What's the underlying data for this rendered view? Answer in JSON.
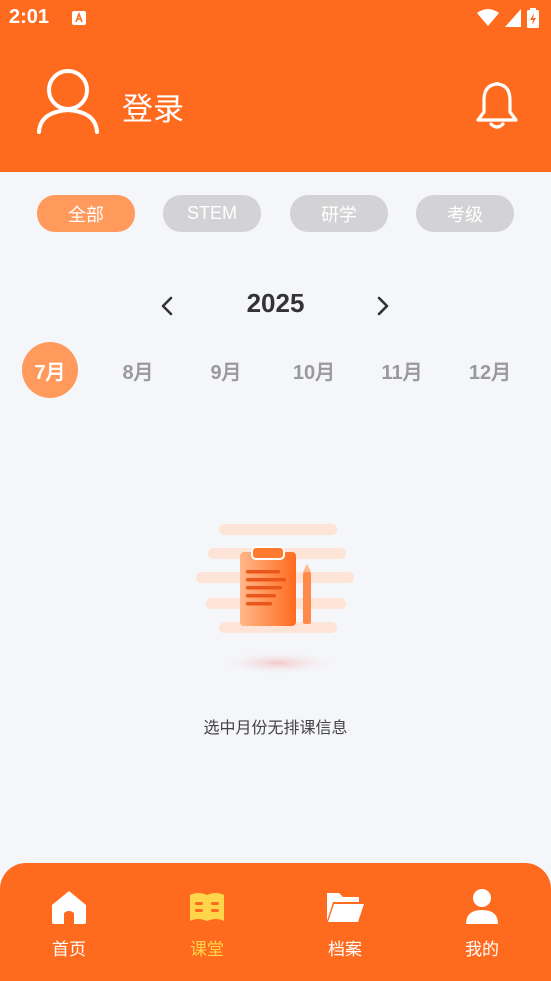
{
  "status_bar": {
    "time": "2:01"
  },
  "header": {
    "login_label": "登录"
  },
  "filters": [
    {
      "label": "全部",
      "active": true
    },
    {
      "label": "STEM",
      "active": false
    },
    {
      "label": "研学",
      "active": false
    },
    {
      "label": "考级",
      "active": false
    }
  ],
  "calendar": {
    "year": "2025",
    "months": [
      {
        "label": "7月",
        "active": true
      },
      {
        "label": "8月",
        "active": false
      },
      {
        "label": "9月",
        "active": false
      },
      {
        "label": "10月",
        "active": false
      },
      {
        "label": "11月",
        "active": false
      },
      {
        "label": "12月",
        "active": false
      }
    ]
  },
  "empty_state": {
    "message": "选中月份无排课信息"
  },
  "tabbar": {
    "items": [
      {
        "label": "首页",
        "icon": "home-icon",
        "active": false
      },
      {
        "label": "课堂",
        "icon": "book-icon",
        "active": true
      },
      {
        "label": "档案",
        "icon": "folder-icon",
        "active": false
      },
      {
        "label": "我的",
        "icon": "person-icon",
        "active": false
      }
    ]
  },
  "colors": {
    "brand": "#ff6b1e",
    "chip_active": "#ff9a5c",
    "chip_inactive": "#d3d3d6",
    "tab_active": "#ffd54a",
    "background": "#f5f6fa"
  }
}
